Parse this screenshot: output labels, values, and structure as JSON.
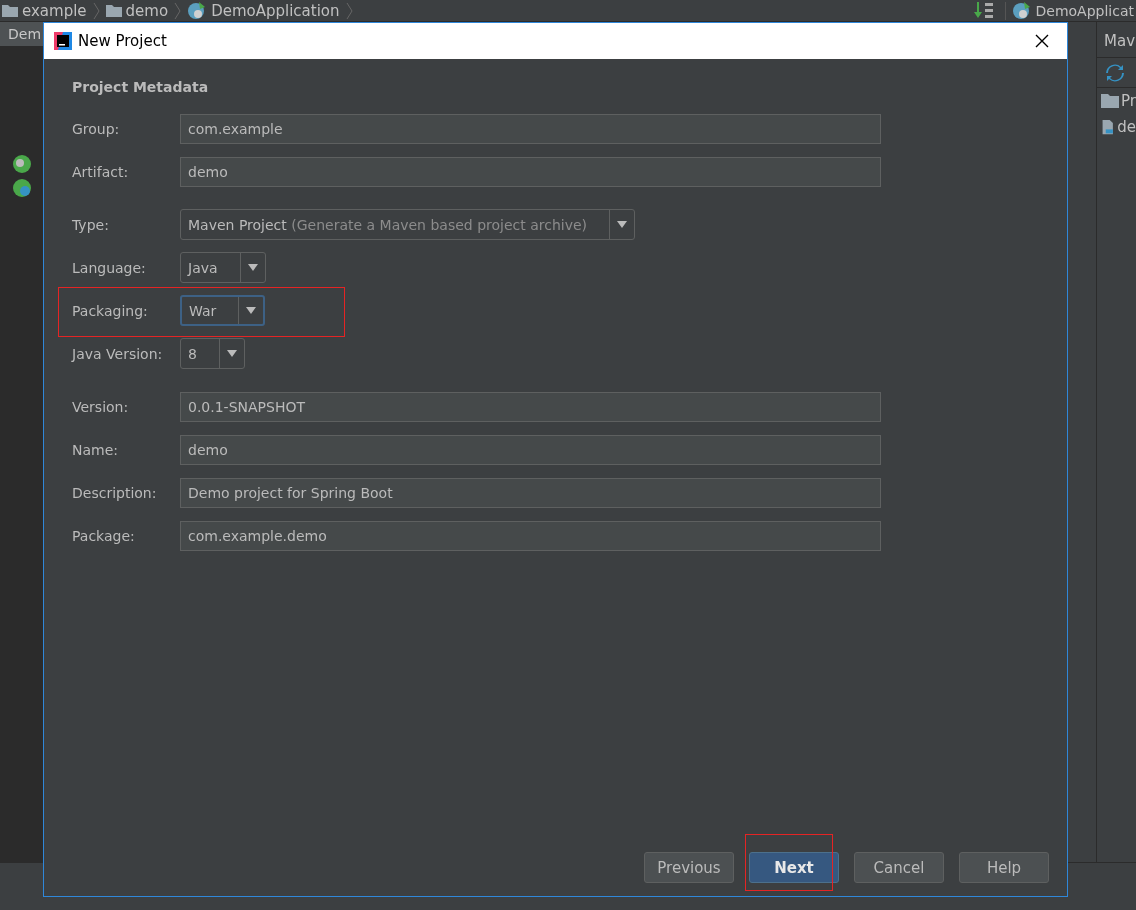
{
  "ide": {
    "breadcrumbs": [
      {
        "label": "example",
        "kind": "folder"
      },
      {
        "label": "demo",
        "kind": "folder"
      },
      {
        "label": "DemoApplication",
        "kind": "class"
      }
    ],
    "run_config": "DemoApplicat",
    "editor_tab": "Dem",
    "tool_window": {
      "title": "Mav",
      "tree": [
        {
          "label": "Pr",
          "kind": "project"
        },
        {
          "label": "de",
          "kind": "module"
        }
      ]
    }
  },
  "dialog": {
    "title": "New Project",
    "section": "Project Metadata",
    "field_groups": [
      [
        {
          "label": "Group:",
          "kind": "text",
          "value": "com.example"
        },
        {
          "label": "Artifact:",
          "kind": "text",
          "value": "demo"
        }
      ],
      [
        {
          "label": "Type:",
          "kind": "select",
          "value": "Maven Project",
          "hint": "(Generate a Maven based project archive)",
          "focused": false,
          "highlighted": false
        },
        {
          "label": "Language:",
          "kind": "select",
          "value": "Java",
          "focused": false,
          "highlighted": false
        },
        {
          "label": "Packaging:",
          "kind": "select",
          "value": "War",
          "focused": true,
          "highlighted": true
        },
        {
          "label": "Java Version:",
          "kind": "select",
          "value": "8",
          "focused": false,
          "highlighted": false
        }
      ],
      [
        {
          "label": "Version:",
          "kind": "text",
          "value": "0.0.1-SNAPSHOT"
        },
        {
          "label": "Name:",
          "kind": "text",
          "value": "demo"
        },
        {
          "label": "Description:",
          "kind": "text",
          "value": "Demo project for Spring Boot"
        },
        {
          "label": "Package:",
          "kind": "text",
          "value": "com.example.demo"
        }
      ]
    ],
    "buttons": [
      {
        "label": "Previous",
        "default": false,
        "highlighted": false
      },
      {
        "label": "Next",
        "default": true,
        "highlighted": true
      },
      {
        "label": "Cancel",
        "default": false,
        "highlighted": false
      },
      {
        "label": "Help",
        "default": false,
        "highlighted": false
      }
    ]
  }
}
